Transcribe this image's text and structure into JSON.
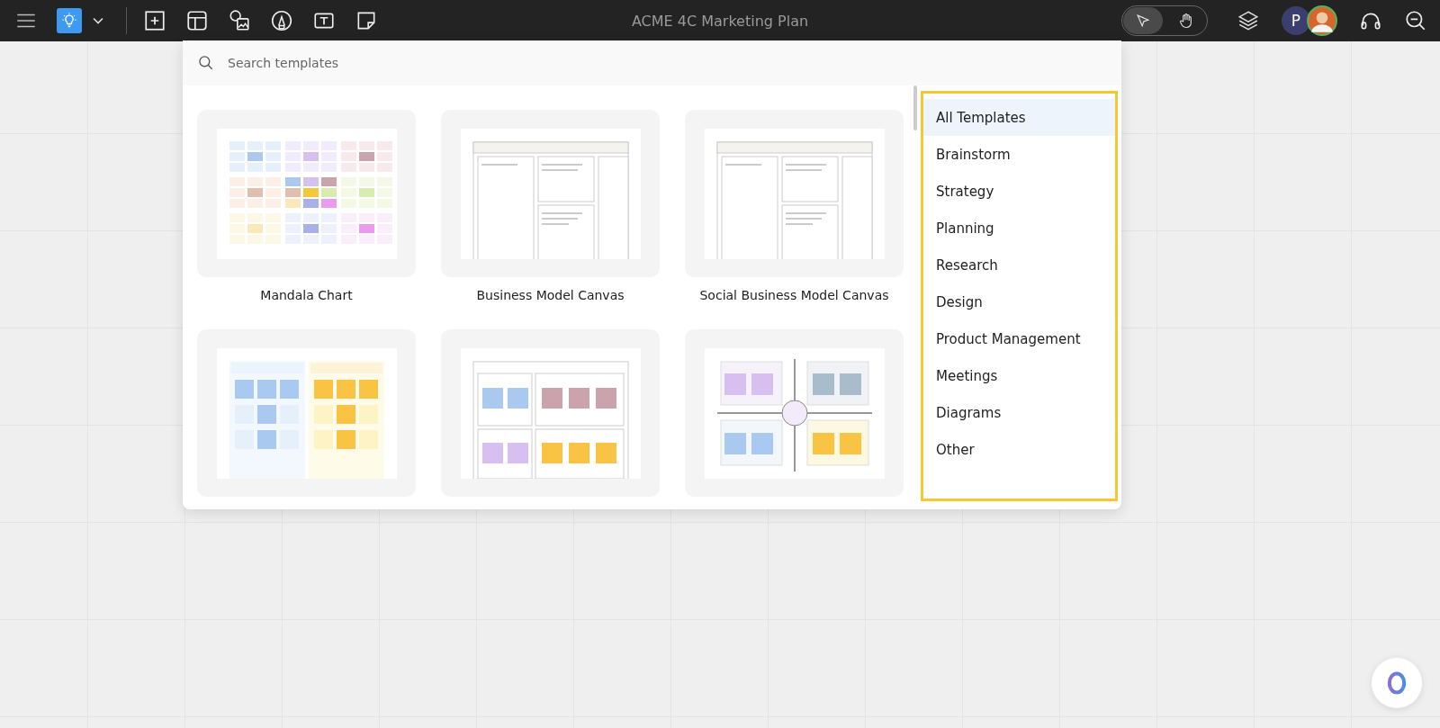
{
  "topbar": {
    "title": "ACME 4C Marketing Plan",
    "avatar_initial": "P",
    "tools": [
      {
        "kind": "select",
        "selected": true
      },
      {
        "kind": "hand",
        "selected": false
      }
    ]
  },
  "template_panel": {
    "search": {
      "placeholder": "Search templates"
    },
    "templates": [
      {
        "name": "Mandala Chart",
        "kind": "mandala"
      },
      {
        "name": "Business Model Canvas",
        "kind": "canvas"
      },
      {
        "name": "Social Business Model Canvas",
        "kind": "canvas"
      },
      {
        "kind": "proscons"
      },
      {
        "kind": "leanux"
      },
      {
        "kind": "empathy"
      }
    ],
    "categories": [
      {
        "label": "All Templates",
        "selected": true
      },
      {
        "label": "Brainstorm",
        "selected": false
      },
      {
        "label": "Strategy",
        "selected": false
      },
      {
        "label": "Planning",
        "selected": false
      },
      {
        "label": "Research",
        "selected": false
      },
      {
        "label": "Design",
        "selected": false
      },
      {
        "label": "Product Management",
        "selected": false
      },
      {
        "label": "Meetings",
        "selected": false
      },
      {
        "label": "Diagrams",
        "selected": false
      },
      {
        "label": "Other",
        "selected": false
      }
    ]
  }
}
